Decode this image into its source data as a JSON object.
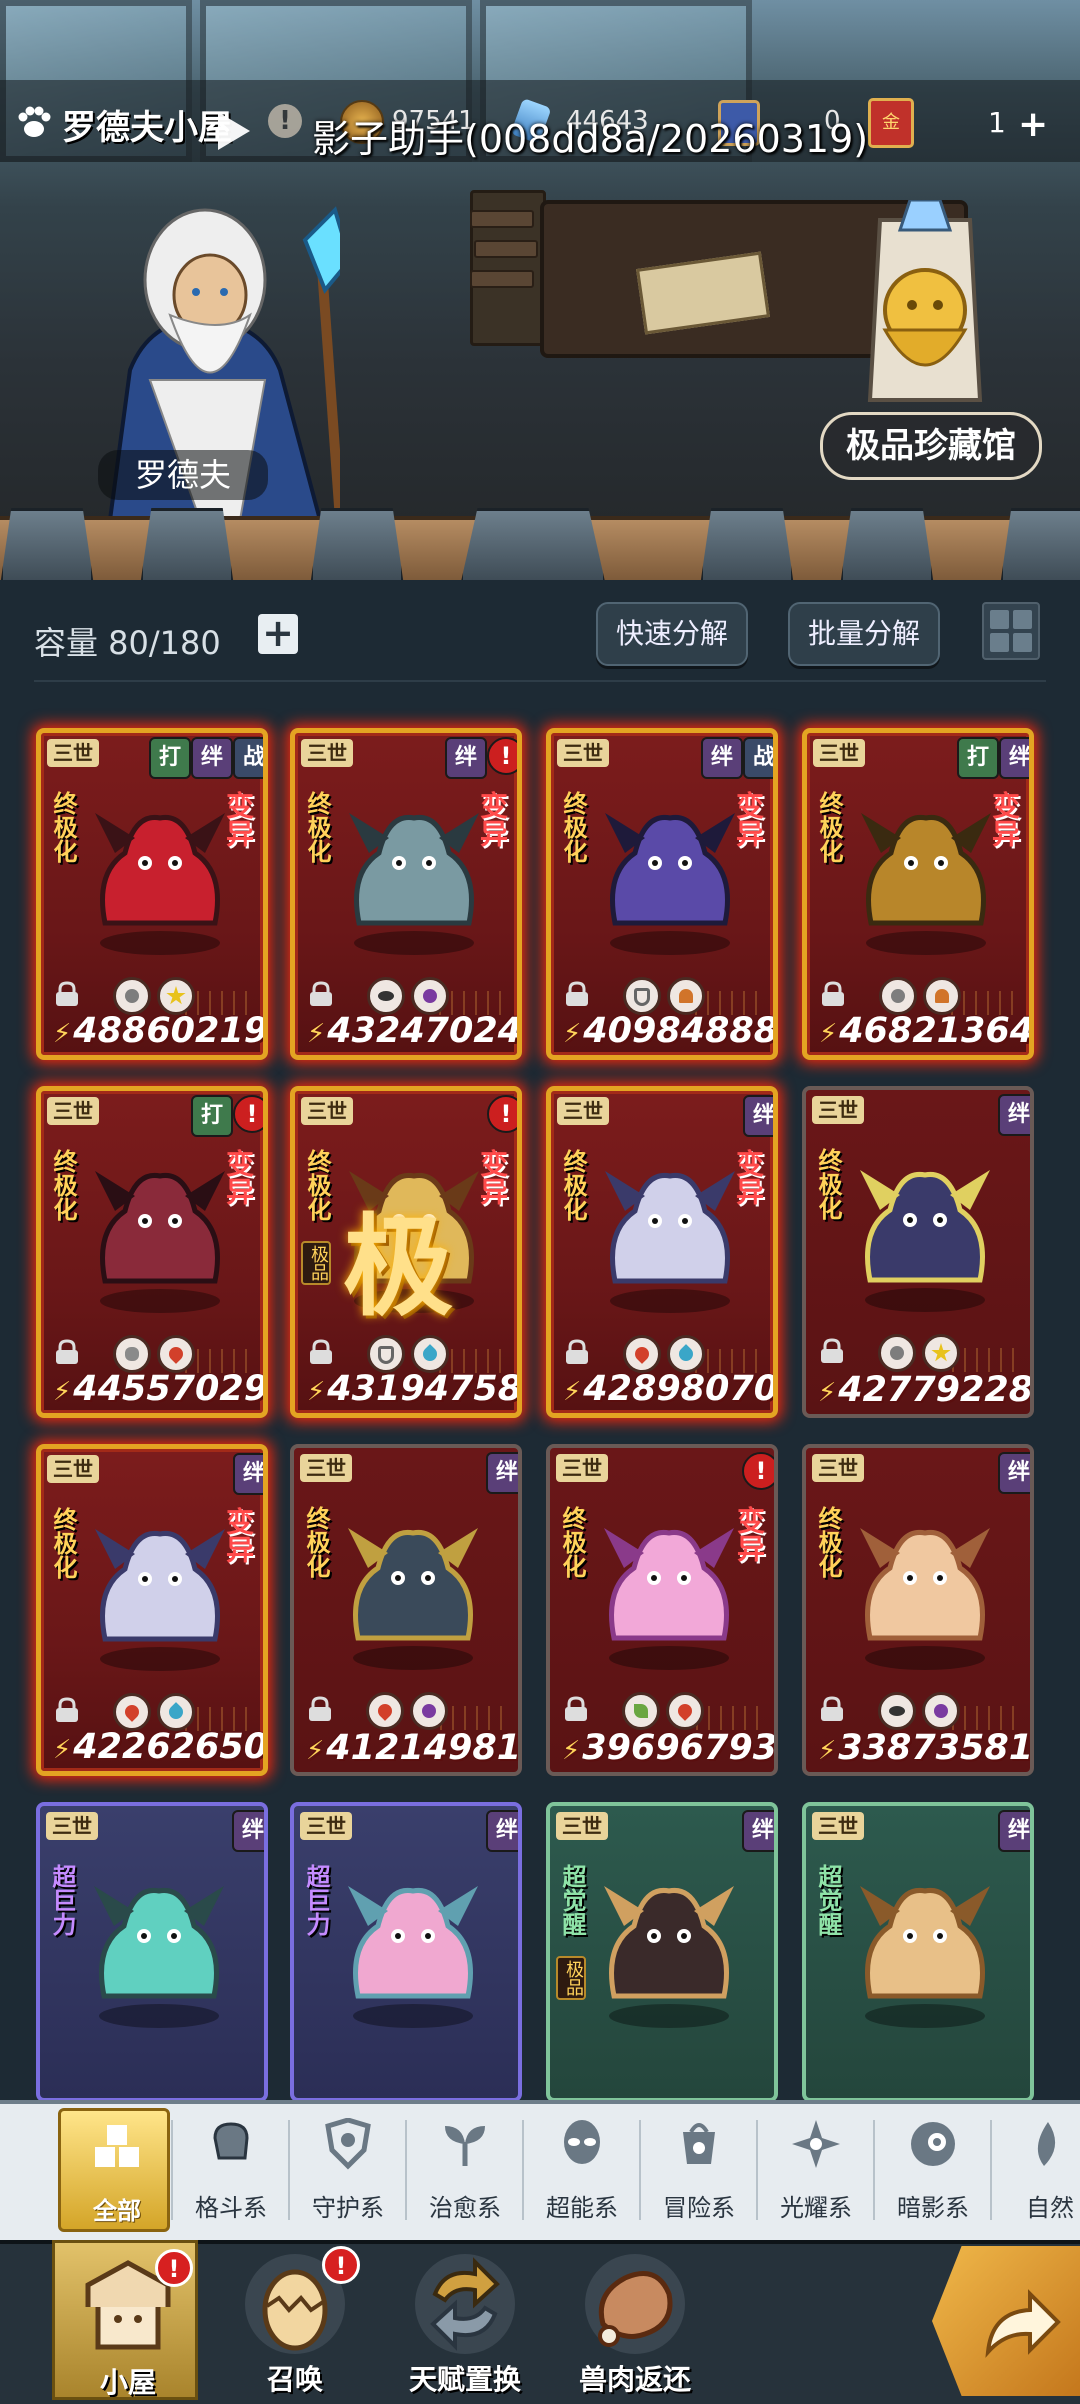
{
  "header": {
    "title": "罗德夫小屋",
    "overlay_text": "影子助手(008dd8a/20260319)",
    "currencies": [
      "97541",
      "44643",
      "0",
      "1"
    ]
  },
  "scene": {
    "npc_name": "罗德夫",
    "vault_button": "极品珍藏馆"
  },
  "storage": {
    "capacity_label": "容量 80/180",
    "quick_decompose": "快速分解",
    "batch_decompose": "批量分解"
  },
  "cards": [
    {
      "tier": "三世",
      "tags": [
        "打",
        "绊",
        "战"
      ],
      "left": "终极化",
      "right": "变异",
      "elements": [
        "light-plain",
        "light"
      ],
      "power": "48860219",
      "style": "red"
    },
    {
      "tier": "三世",
      "tags": [
        "绊",
        "!"
      ],
      "left": "终极化",
      "right": "变异",
      "elements": [
        "eye",
        "dark"
      ],
      "power": "43247024",
      "style": "red"
    },
    {
      "tier": "三世",
      "tags": [
        "绊",
        "战"
      ],
      "left": "终极化",
      "right": "变异",
      "elements": [
        "shield",
        "earth"
      ],
      "power": "40984888",
      "style": "red"
    },
    {
      "tier": "三世",
      "tags": [
        "打",
        "绊"
      ],
      "left": "终极化",
      "right": "变异",
      "elements": [
        "plain",
        "earth"
      ],
      "power": "46821364",
      "style": "red"
    },
    {
      "tier": "三世",
      "tags": [
        "打",
        "!"
      ],
      "left": "终极化",
      "right": "变异",
      "elements": [
        "fist",
        "fire"
      ],
      "power": "44557029",
      "style": "red"
    },
    {
      "tier": "三世",
      "tags": [
        "!"
      ],
      "left": "终极化",
      "right": "变异",
      "badge": "极品",
      "big": "极",
      "elements": [
        "shield",
        "water"
      ],
      "power": "43194758",
      "style": "red"
    },
    {
      "tier": "三世",
      "tags": [
        "绊"
      ],
      "left": "终极化",
      "right": "变异",
      "elements": [
        "fire",
        "water"
      ],
      "power": "42898070",
      "style": "red"
    },
    {
      "tier": "三世",
      "tags": [
        "绊"
      ],
      "left": "终极化",
      "right": "",
      "elements": [
        "plain",
        "light"
      ],
      "power": "42779228",
      "style": "dim"
    },
    {
      "tier": "三世",
      "tags": [
        "绊"
      ],
      "left": "终极化",
      "right": "变异",
      "elements": [
        "fire",
        "water"
      ],
      "power": "42262650",
      "style": "red"
    },
    {
      "tier": "三世",
      "tags": [
        "绊"
      ],
      "left": "终极化",
      "right": "",
      "elements": [
        "fire",
        "dark"
      ],
      "power": "41214981",
      "style": "dim"
    },
    {
      "tier": "三世",
      "tags": [
        "!"
      ],
      "left": "终极化",
      "right": "变异",
      "elements": [
        "leaf",
        "fire"
      ],
      "power": "39696793",
      "style": "dim"
    },
    {
      "tier": "三世",
      "tags": [
        "绊"
      ],
      "left": "终极化",
      "right": "",
      "elements": [
        "eye",
        "dark"
      ],
      "power": "33873581",
      "style": "dim"
    },
    {
      "tier": "三世",
      "tags": [
        "绊"
      ],
      "left": "超巨力",
      "right": "",
      "elements": [],
      "power": "",
      "style": "purple"
    },
    {
      "tier": "三世",
      "tags": [
        "绊"
      ],
      "left": "超巨力",
      "right": "",
      "elements": [],
      "power": "",
      "style": "purple"
    },
    {
      "tier": "三世",
      "tags": [
        "绊"
      ],
      "left": "超觉醒",
      "right": "",
      "badge": "极品",
      "elements": [],
      "power": "",
      "style": "green"
    },
    {
      "tier": "三世",
      "tags": [
        "绊"
      ],
      "left": "超觉醒",
      "right": "",
      "elements": [],
      "power": "",
      "style": "green"
    }
  ],
  "category_tabs": [
    {
      "label": "全部",
      "icon": "all-icon"
    },
    {
      "label": "格斗系",
      "icon": "fist-icon"
    },
    {
      "label": "守护系",
      "icon": "shield-icon"
    },
    {
      "label": "治愈系",
      "icon": "sprout-icon"
    },
    {
      "label": "超能系",
      "icon": "alien-icon"
    },
    {
      "label": "冒险系",
      "icon": "lantern-icon"
    },
    {
      "label": "光耀系",
      "icon": "star-burst-icon"
    },
    {
      "label": "暗影系",
      "icon": "eye-icon"
    },
    {
      "label": "自然",
      "icon": "leaf-icon"
    }
  ],
  "bottom_nav": [
    {
      "label": "小屋",
      "icon": "house-icon",
      "badge": "!"
    },
    {
      "label": "召唤",
      "icon": "egg-icon",
      "badge": "!"
    },
    {
      "label": "天赋置换",
      "icon": "swap-icon"
    },
    {
      "label": "兽肉返还",
      "icon": "meat-icon"
    }
  ],
  "colors": {
    "accent_gold": "#e4a422",
    "alert_red": "#cc1f1f",
    "panel": "#1d2a34"
  }
}
